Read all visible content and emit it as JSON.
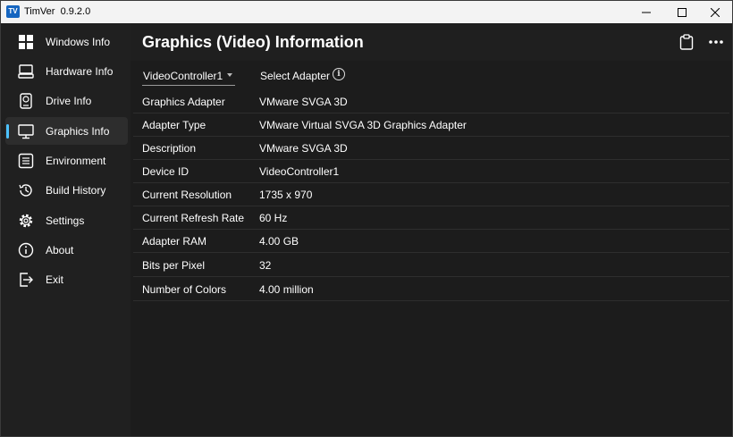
{
  "window": {
    "app_icon_text": "TV",
    "title": "TimVer",
    "version": "0.9.2.0"
  },
  "sidebar": {
    "items": [
      {
        "label": "Windows Info",
        "icon": "windows-icon"
      },
      {
        "label": "Hardware Info",
        "icon": "keyboard-icon"
      },
      {
        "label": "Drive Info",
        "icon": "drive-icon"
      },
      {
        "label": "Graphics Info",
        "icon": "monitor-icon",
        "active": true
      },
      {
        "label": "Environment",
        "icon": "list-icon"
      },
      {
        "label": "Build History",
        "icon": "history-icon"
      },
      {
        "label": "Settings",
        "icon": "gear-icon"
      },
      {
        "label": "About",
        "icon": "info-icon"
      },
      {
        "label": "Exit",
        "icon": "exit-icon"
      }
    ]
  },
  "main": {
    "title": "Graphics (Video) Information",
    "adapter_selector": {
      "value": "VideoController1"
    },
    "select_adapter_label": "Select Adapter",
    "rows": [
      {
        "key": "Graphics Adapter",
        "value": "VMware SVGA 3D"
      },
      {
        "key": "Adapter Type",
        "value": "VMware Virtual SVGA 3D Graphics Adapter"
      },
      {
        "key": "Description",
        "value": "VMware SVGA 3D"
      },
      {
        "key": "Device ID",
        "value": "VideoController1"
      },
      {
        "key": "Current Resolution",
        "value": "1735 x 970"
      },
      {
        "key": "Current Refresh Rate",
        "value": "60 Hz"
      },
      {
        "key": "Adapter RAM",
        "value": "4.00 GB"
      },
      {
        "key": "Bits per Pixel",
        "value": "32"
      },
      {
        "key": "Number of Colors",
        "value": "4.00 million"
      }
    ]
  },
  "colors": {
    "accent": "#4cc2ff",
    "window_bg": "#202020",
    "content_bg": "#1c1c1c",
    "titlebar_bg": "#f3f3f3"
  }
}
